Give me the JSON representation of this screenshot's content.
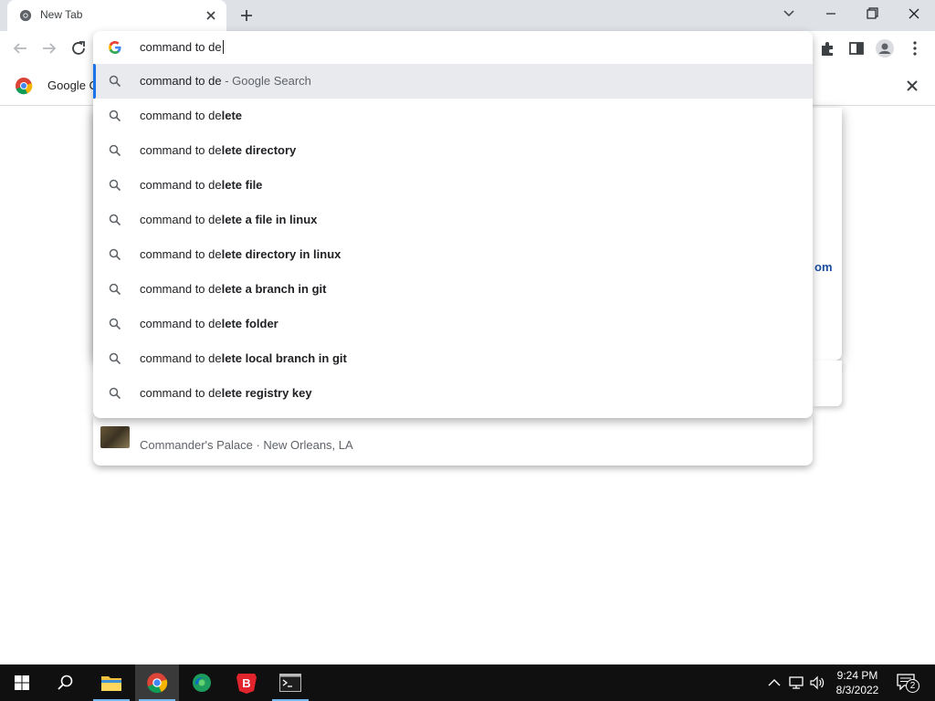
{
  "browser": {
    "tab_title": "New Tab",
    "bookmark_label": "Google C"
  },
  "omnibox": {
    "query": "command to de",
    "suggestions": [
      {
        "prefix": "command to de",
        "bold": "",
        "suffix": " - Google Search",
        "selected": true
      },
      {
        "prefix": "command to de",
        "bold": "lete",
        "suffix": "",
        "selected": false
      },
      {
        "prefix": "command to de",
        "bold": "lete directory",
        "suffix": "",
        "selected": false
      },
      {
        "prefix": "command to de",
        "bold": "lete file",
        "suffix": "",
        "selected": false
      },
      {
        "prefix": "command to de",
        "bold": "lete a file in linux",
        "suffix": "",
        "selected": false
      },
      {
        "prefix": "command to de",
        "bold": "lete directory in linux",
        "suffix": "",
        "selected": false
      },
      {
        "prefix": "command to de",
        "bold": "lete a branch in git",
        "suffix": "",
        "selected": false
      },
      {
        "prefix": "command to de",
        "bold": "lete folder",
        "suffix": "",
        "selected": false
      },
      {
        "prefix": "command to de",
        "bold": "lete local branch in git",
        "suffix": "",
        "selected": false
      },
      {
        "prefix": "command to de",
        "bold": "lete registry key",
        "suffix": "",
        "selected": false
      }
    ]
  },
  "background": {
    "partial_link": "om",
    "recent_item": "Commander's Palace · New Orleans, LA"
  },
  "taskbar": {
    "time": "9:24 PM",
    "date": "8/3/2022",
    "notification_count": "2",
    "apps": [
      "start-button",
      "search-button",
      "file-explorer",
      "chrome",
      "edge",
      "brave",
      "terminal"
    ]
  },
  "colors": {
    "accent": "#1a73e8",
    "tabstrip": "#dee1e6",
    "taskbar": "#101010"
  }
}
